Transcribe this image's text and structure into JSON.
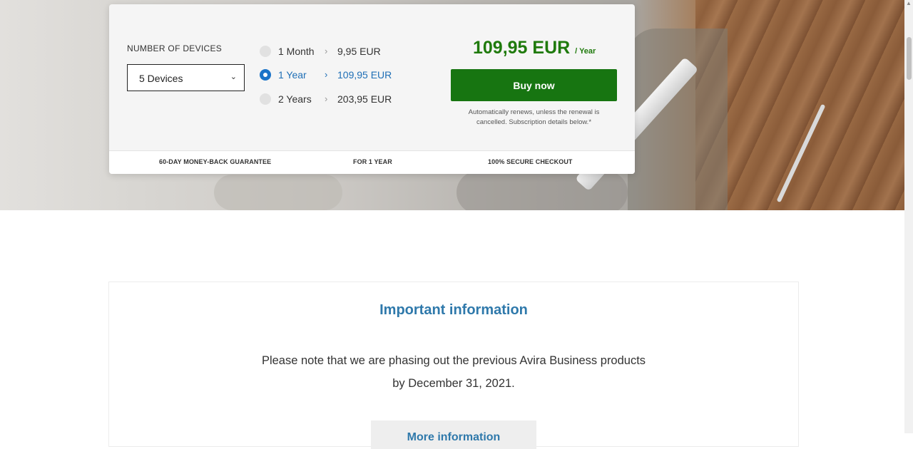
{
  "product": {
    "devices_label": "NUMBER OF DEVICES",
    "devices_selected": "5 Devices",
    "options": [
      {
        "term": "1 Month",
        "price": "9,95 EUR",
        "selected": false
      },
      {
        "term": "1 Year",
        "price": "109,95 EUR",
        "selected": true
      },
      {
        "term": "2 Years",
        "price": "203,95 EUR",
        "selected": false
      }
    ],
    "price": "109,95 EUR",
    "price_period": "/ Year",
    "buy_label": "Buy now",
    "renew_note": "Automatically renews, unless the renewal is cancelled. Subscription details below.*",
    "footer": {
      "guarantee": "60-DAY MONEY-BACK GUARANTEE",
      "term": "FOR 1 YEAR",
      "secure": "100% SECURE CHECKOUT"
    }
  },
  "info": {
    "title": "Important information",
    "line1": "Please note that we are phasing out the previous Avira Business products",
    "line2": "by December 31, 2021.",
    "button_label": "More information"
  },
  "colors": {
    "price_green": "#1f7a0c",
    "buy_green": "#177511",
    "accent_blue": "#1f6fb6",
    "title_blue": "#2f79ab"
  },
  "icons": [
    "chevron-down-icon",
    "chevron-right-icon",
    "radio-icon"
  ]
}
